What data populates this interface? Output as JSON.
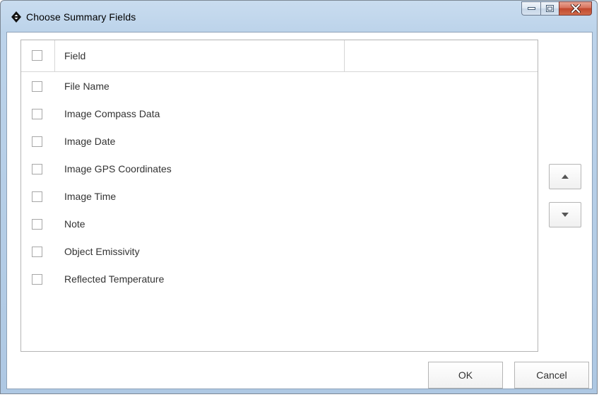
{
  "window": {
    "title": "Choose Summary Fields",
    "icon": "flir-diamond-icon",
    "controls": [
      "minimize-icon",
      "maximize-icon",
      "close-icon"
    ],
    "close_button_color": "#c7472d"
  },
  "table": {
    "header": {
      "select_all_checked": false,
      "columns": [
        "Field",
        ""
      ]
    },
    "rows": [
      {
        "label": "File Name",
        "checked": false
      },
      {
        "label": "Image Compass Data",
        "checked": false
      },
      {
        "label": "Image Date",
        "checked": false
      },
      {
        "label": "Image GPS Coordinates",
        "checked": false
      },
      {
        "label": "Image Time",
        "checked": false
      },
      {
        "label": "Note",
        "checked": false
      },
      {
        "label": "Object Emissivity",
        "checked": false
      },
      {
        "label": "Reflected Temperature",
        "checked": false
      }
    ]
  },
  "reorder": {
    "up_icon": "triangle-up-icon",
    "down_icon": "triangle-down-icon"
  },
  "buttons": {
    "ok": "OK",
    "cancel": "Cancel"
  }
}
